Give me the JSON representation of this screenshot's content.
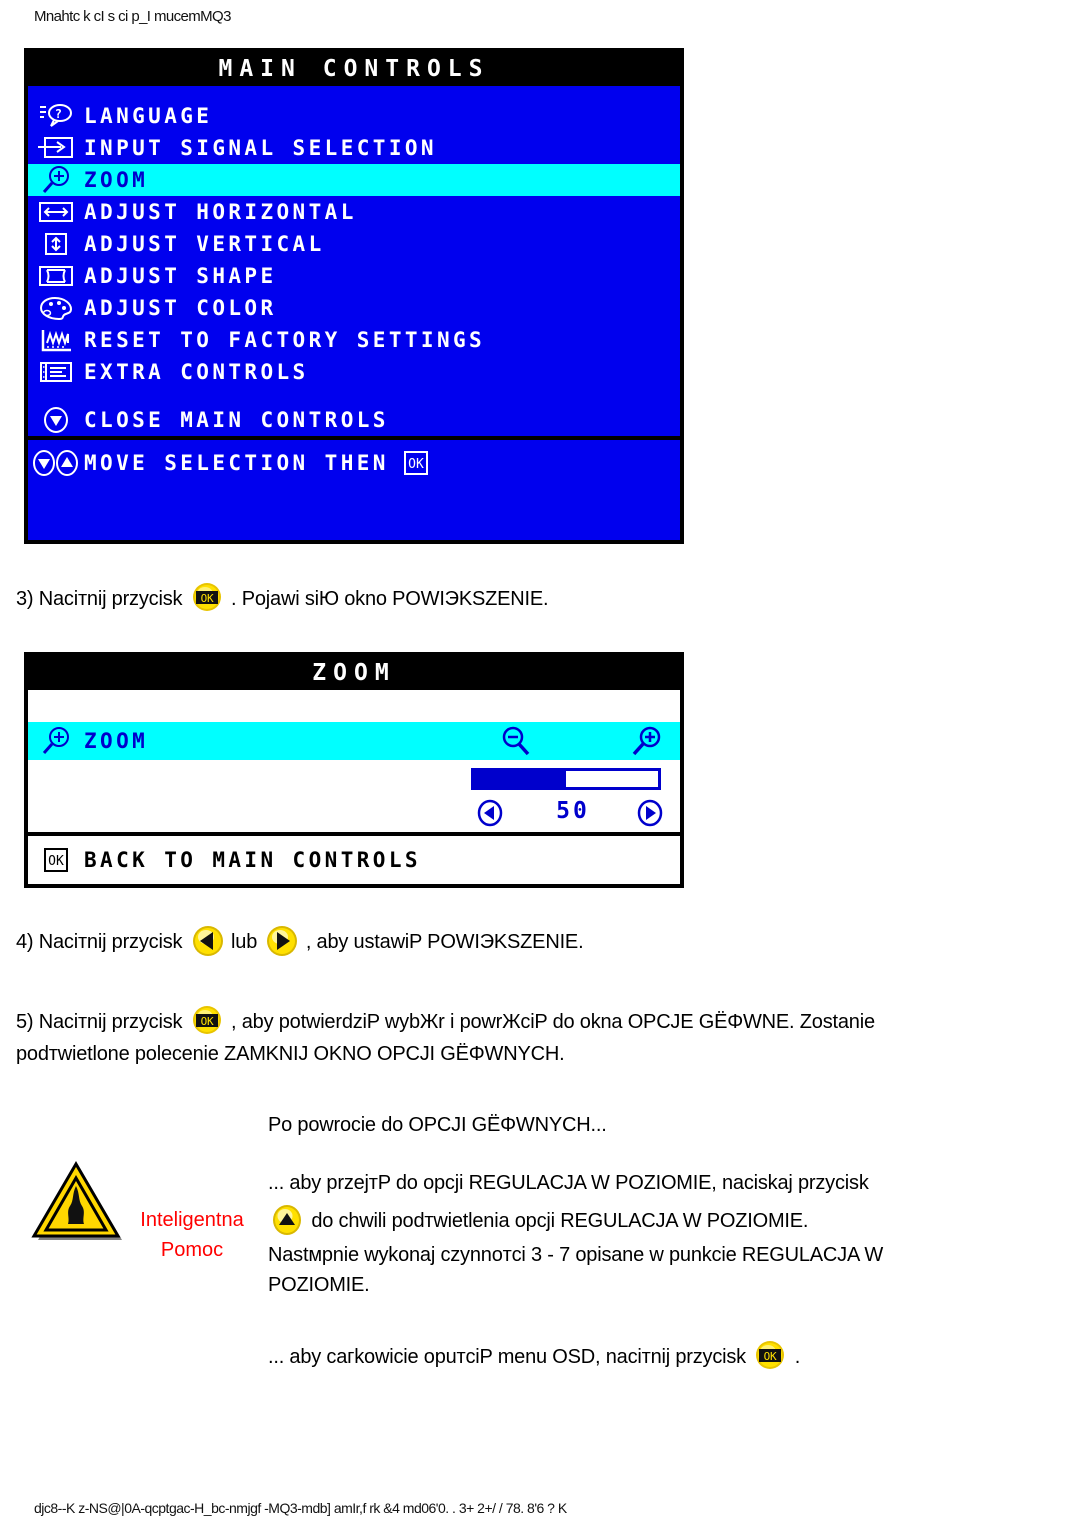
{
  "document": {
    "header_garbled": "Mnahtc k cI s ci p_I mucemMQ3",
    "footer_garbled": "djc8--K z-NS@|0A-qcptgac-H_bc-nmjgf -MQ3-mdb] amIr,f rk  &4 md06'0. . 3+ 2+/ / 78. 8'6 ? K"
  },
  "main_controls": {
    "title": "MAIN CONTROLS",
    "items": [
      {
        "icon": "language-icon",
        "label": "LANGUAGE",
        "selected": false
      },
      {
        "icon": "input-signal-icon",
        "label": "INPUT SIGNAL SELECTION",
        "selected": false
      },
      {
        "icon": "zoom-magnifier-icon",
        "label": "ZOOM",
        "selected": true
      },
      {
        "icon": "adjust-horizontal-icon",
        "label": "ADJUST HORIZONTAL",
        "selected": false
      },
      {
        "icon": "adjust-vertical-icon",
        "label": "ADJUST VERTICAL",
        "selected": false
      },
      {
        "icon": "adjust-shape-icon",
        "label": "ADJUST SHAPE",
        "selected": false
      },
      {
        "icon": "adjust-color-icon",
        "label": "ADJUST COLOR",
        "selected": false
      },
      {
        "icon": "reset-factory-icon",
        "label": "RESET TO FACTORY SETTINGS",
        "selected": false
      },
      {
        "icon": "extra-controls-icon",
        "label": "EXTRA CONTROLS",
        "selected": false
      }
    ],
    "close_item": {
      "icon": "down-arrow-icon",
      "label": "CLOSE MAIN CONTROLS"
    },
    "footer": {
      "icons": "down-up-arrow-icons",
      "label": "MOVE SELECTION THEN",
      "ok_icon": "ok-button-icon"
    }
  },
  "zoom_panel": {
    "title": "ZOOM",
    "row_label": "ZOOM",
    "row_icon": "zoom-magnifier-icon",
    "minus_icon": "magnifier-minus-icon",
    "plus_icon": "magnifier-plus-icon",
    "left_arrow_icon": "left-arrow-icon",
    "right_arrow_icon": "right-arrow-icon",
    "value": "50",
    "slider_percent": 50,
    "footer": {
      "ok_icon": "ok-button-icon",
      "label": "BACK TO MAIN CONTROLS"
    }
  },
  "steps": {
    "step3_a": "3) Naciтnij przycisk",
    "step3_b": ". Pojawi siЮ okno POWIЭKSZENIE.",
    "step4_a": "4) Naciтnij przycisk",
    "step4_mid": "lub",
    "step4_b": ", aby ustawiP POWIЭKSZENIE.",
    "step5_a": "5) Naciтnij przycisk",
    "step5_b": ", aby potwierdziP wybЖr i powrЖciP do okna OPCJE GЁΦWNE. Zostanie",
    "step5_line2": "podтwietlone polecenie ZAMKNIJ OKNO OPCJI GЁΦWNYCH."
  },
  "help": {
    "icon": "warning-triangle-icon",
    "label_line1": "Inteligentna",
    "label_line2": "Pomoc",
    "label_color": "#FF0000",
    "intro": "Po powrocie do OPCJI GЁΦWNYCH...",
    "p1_a": "... aby przejтP do opcji REGULACJA W POZIOMIE, naciskaj przycisk",
    "p1_b": "do chwili podтwietlenia opcji REGULACJA W POZIOMIE.",
    "up_arrow_icon": "up-arrow-icon",
    "p2": "Nastмpnie wykonaj czynnoтci 3 - 7 opisane w punkcie REGULACJA W POZIOMIE.",
    "exit_a": "... aby caгkowicie opuтciP menu OSD, naciтnij przycisk",
    "exit_b": ".",
    "ok_icon": "ok-button-icon"
  },
  "colors": {
    "osd_blue": "#0000EE",
    "osd_highlight": "#00FFFF",
    "osd_text": "#FFFFFF",
    "osd_sel_text": "#0000CC",
    "button_yellow": "#FFDD00",
    "help_red": "#FF0000",
    "black": "#000000"
  }
}
